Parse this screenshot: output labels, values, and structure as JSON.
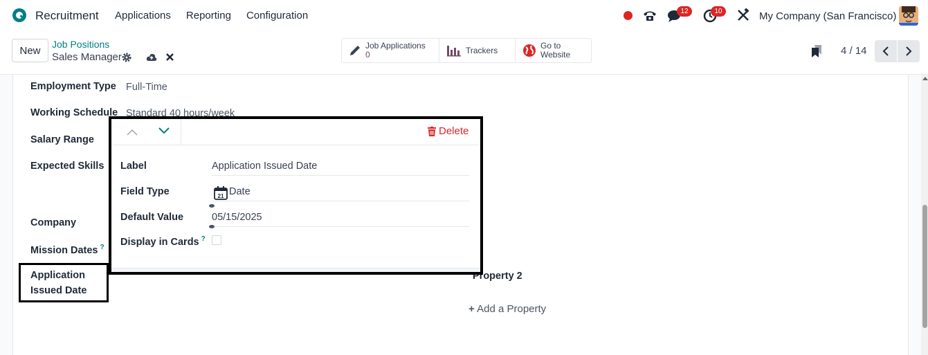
{
  "topnav": {
    "app_name": "Recruitment",
    "menu": [
      "Applications",
      "Reporting",
      "Configuration"
    ],
    "chat_badge": "12",
    "activity_badge": "10",
    "company": "My Company (San Francisco)",
    "brand_color": "#714b67",
    "accent_color": "#017e84"
  },
  "control": {
    "new_label": "New",
    "breadcrumb": "Job Positions",
    "record_name": "Sales Manager",
    "smart_buttons": [
      {
        "label": "Job Applications",
        "value": "0",
        "icon": "pencil-icon"
      },
      {
        "label": "Trackers",
        "icon": "bar-chart-icon"
      },
      {
        "label": "Go to",
        "label2": "Website",
        "icon": "globe-icon"
      }
    ],
    "pager": "4 / 14"
  },
  "form": {
    "fields": [
      {
        "label": "Employment Type",
        "value": "Full-Time"
      },
      {
        "label": "Working Schedule",
        "value": "Standard 40 hours/week"
      },
      {
        "label": "Salary Range",
        "value": ""
      },
      {
        "label": "Expected Skills",
        "value": ""
      },
      {
        "label": "Company",
        "value": ""
      },
      {
        "label": "Mission Dates",
        "value": "",
        "help": "?"
      }
    ],
    "application_issued_date_line1": "Application",
    "application_issued_date_line2": "Issued Date",
    "property2": "Property 2",
    "add_property": "Add a Property"
  },
  "popover": {
    "delete_label": "Delete",
    "label_label": "Label",
    "label_value": "Application Issued Date",
    "field_type_label": "Field Type",
    "field_type_value": "Date",
    "calendar_day": "21",
    "default_value_label": "Default Value",
    "default_value": "05/15/2025",
    "display_in_cards_label": "Display in Cards",
    "display_in_cards_help": "?",
    "display_in_cards_checked": false
  }
}
